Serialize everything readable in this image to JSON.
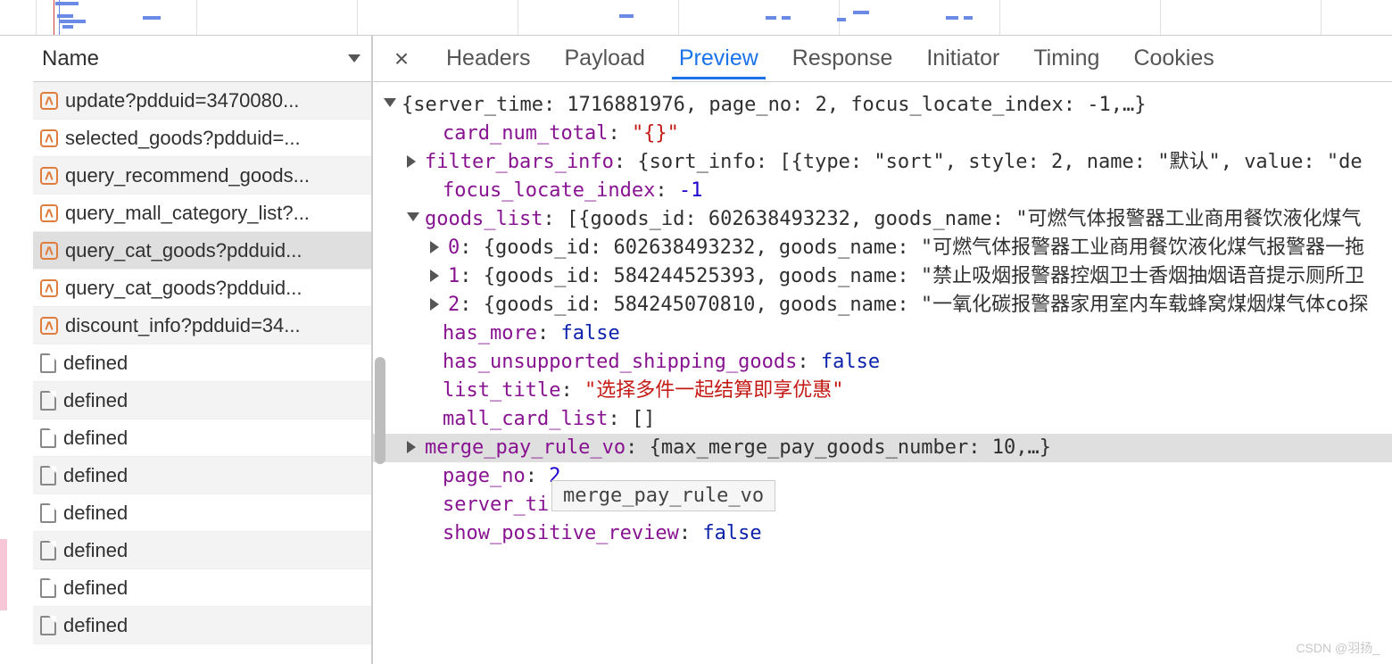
{
  "waterfall": {
    "segments": []
  },
  "sidebar": {
    "header": "Name",
    "requests": [
      {
        "kind": "xhr",
        "label": "update?pdduid=3470080...",
        "zebra": true
      },
      {
        "kind": "xhr",
        "label": "selected_goods?pdduid=...",
        "zebra": false
      },
      {
        "kind": "xhr",
        "label": "query_recommend_goods...",
        "zebra": true
      },
      {
        "kind": "xhr",
        "label": "query_mall_category_list?...",
        "zebra": false
      },
      {
        "kind": "xhr",
        "label": "query_cat_goods?pdduid...",
        "selected": true
      },
      {
        "kind": "xhr",
        "label": "query_cat_goods?pdduid...",
        "zebra": false
      },
      {
        "kind": "xhr",
        "label": "discount_info?pdduid=34...",
        "zebra": true
      },
      {
        "kind": "file",
        "label": "defined",
        "zebra": false
      },
      {
        "kind": "file",
        "label": "defined",
        "zebra": true
      },
      {
        "kind": "file",
        "label": "defined",
        "zebra": false
      },
      {
        "kind": "file",
        "label": "defined",
        "zebra": true
      },
      {
        "kind": "file",
        "label": "defined",
        "zebra": false
      },
      {
        "kind": "file",
        "label": "defined",
        "zebra": true
      },
      {
        "kind": "file",
        "label": "defined",
        "zebra": false
      },
      {
        "kind": "file",
        "label": "defined",
        "zebra": true
      }
    ]
  },
  "tabs": {
    "headers": "Headers",
    "payload": "Payload",
    "preview": "Preview",
    "response": "Response",
    "initiator": "Initiator",
    "timing": "Timing",
    "cookies": "Cookies"
  },
  "preview": {
    "root_summary_a": "{server_time: 1716881976, page_no: 2, focus_locate_index: -1,",
    "root_summary_b": "…}",
    "card_num_total_key": "card_num_total",
    "card_num_total_val": "\"{}\"",
    "filter_bars_info_key": "filter_bars_info",
    "filter_bars_info_val": "{sort_info: [{type: \"sort\", style: 2, name: \"默认\", value: \"de",
    "focus_locate_index_key": "focus_locate_index",
    "focus_locate_index_val": "-1",
    "goods_list_key": "goods_list",
    "goods_list_summary": "[{goods_id: 602638493232, goods_name: \"可燃气体报警器工业商用餐饮液化煤气",
    "item0_key": "0",
    "item0_val": "{goods_id: 602638493232, goods_name: \"可燃气体报警器工业商用餐饮液化煤气报警器一拖",
    "item1_key": "1",
    "item1_val": "{goods_id: 584244525393, goods_name: \"禁止吸烟报警器控烟卫士香烟抽烟语音提示厕所卫",
    "item2_key": "2",
    "item2_val": "{goods_id: 584245070810, goods_name: \"一氧化碳报警器家用室内车载蜂窝煤烟煤气体co探",
    "has_more_key": "has_more",
    "has_more_val": "false",
    "has_unsupported_key": "has_unsupported_shipping_goods",
    "has_unsupported_val": "false",
    "list_title_key": "list_title",
    "list_title_val": "\"选择多件一起结算即享优惠\"",
    "mall_card_list_key": "mall_card_list",
    "mall_card_list_val": "[]",
    "merge_pay_key": "merge_pay_rule_vo",
    "merge_pay_val": "{max_merge_pay_goods_number: 10,…}",
    "page_no_key": "page_no",
    "page_no_val": "2",
    "server_time_key": "server_ti",
    "show_positive_key": "show_positive_review",
    "show_positive_val": "false"
  },
  "tooltip": "merge_pay_rule_vo",
  "watermark": "CSDN @羽扬_"
}
